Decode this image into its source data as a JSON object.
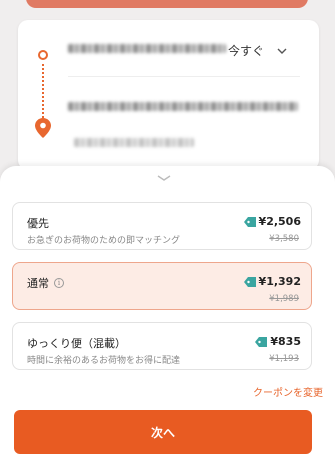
{
  "route": {
    "time_select_label": "今すぐ"
  },
  "delivery_options": [
    {
      "title": "優先",
      "subtitle": "お急ぎのお荷物のための即マッチング",
      "price": "¥2,506",
      "old_price": "¥3,580",
      "selected": false
    },
    {
      "title": "通常",
      "subtitle": "",
      "price": "¥1,392",
      "old_price": "¥1,989",
      "selected": true
    },
    {
      "title": "ゆっくり便（混載）",
      "subtitle": "時間に余裕のあるお荷物をお得に配達",
      "price": "¥835",
      "old_price": "¥1,193",
      "selected": false
    }
  ],
  "coupon_link": "クーポンを変更",
  "next_button_label": "次へ",
  "colors": {
    "accent": "#e85b22",
    "selected_bg": "#fdece5",
    "tag_icon": "#3aa5a0"
  },
  "icons": {
    "pickup": "pickup-dot-icon",
    "destination": "map-pin-icon",
    "time_select": "chevron-down-icon",
    "price_tag": "tag-icon",
    "info": "info-icon"
  }
}
